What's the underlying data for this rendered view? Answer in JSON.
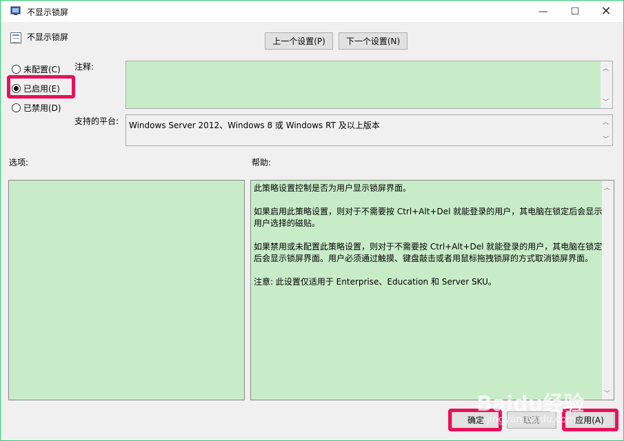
{
  "window": {
    "title": "不显示锁屏",
    "minimize_glyph": "—",
    "maximize_glyph": "☐",
    "close_glyph": "✕"
  },
  "policy": {
    "name": "不显示锁屏"
  },
  "nav": {
    "prev_label": "上一个设置(P)",
    "next_label": "下一个设置(N)"
  },
  "state": {
    "options": [
      {
        "label": "未配置(C)",
        "checked": false
      },
      {
        "label": "已启用(E)",
        "checked": true
      },
      {
        "label": "已禁用(D)",
        "checked": false
      }
    ]
  },
  "labels": {
    "note": "注释:",
    "platform": "支持的平台:",
    "options": "选项:",
    "help": "帮助:"
  },
  "platform_value": "Windows Server 2012、Windows 8 或 Windows RT 及以上版本",
  "help_paragraphs": [
    "此策略设置控制是否为用户显示锁屏界面。",
    "如果启用此策略设置，则对于不需要按 Ctrl+Alt+Del 就能登录的用户，其电脑在锁定后会显示用户选择的磁贴。",
    "如果禁用或未配置此策略设置，则对于不需要按 Ctrl+Alt+Del 就能登录的用户，其电脑在锁定后会显示锁屏界面。用户必须通过触摸、键盘敲击或者用鼠标拖拽锁屏的方式取消锁屏界面。",
    "注意: 此设置仅适用于 Enterprise、Education 和 Server SKU。"
  ],
  "buttons": {
    "ok": "确定",
    "cancel": "取消",
    "apply": "应用(A)"
  },
  "watermark": {
    "brand": "Baidu经验",
    "sub": "jingyan.baidu.com"
  },
  "colors": {
    "highlight": "#e8115a",
    "text_area_bg": "#c8ecc8",
    "window_border": "#2ecc71"
  }
}
